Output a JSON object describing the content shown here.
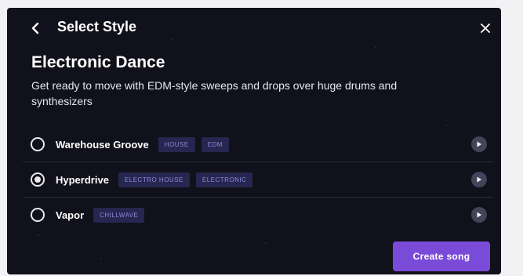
{
  "header": {
    "title": "Select Style",
    "back_icon": "chevron-left-icon",
    "close_icon": "close-icon"
  },
  "genre": {
    "title": "Electronic Dance",
    "description": "Get ready to move with EDM-style sweeps and drops over huge drums and synthesizers"
  },
  "styles": [
    {
      "name": "Warehouse Groove",
      "tags": [
        "HOUSE",
        "EDM"
      ],
      "selected": false
    },
    {
      "name": "Hyperdrive",
      "tags": [
        "ELECTRO HOUSE",
        "ELECTRONIC"
      ],
      "selected": true
    },
    {
      "name": "Vapor",
      "tags": [
        "CHILLWAVE"
      ],
      "selected": false
    }
  ],
  "create_button": {
    "label": "Create song"
  },
  "colors": {
    "background": "#11111b",
    "accent": "#7a4bd9",
    "tag_bg": "#262651",
    "tag_text": "#8a8ad8"
  }
}
